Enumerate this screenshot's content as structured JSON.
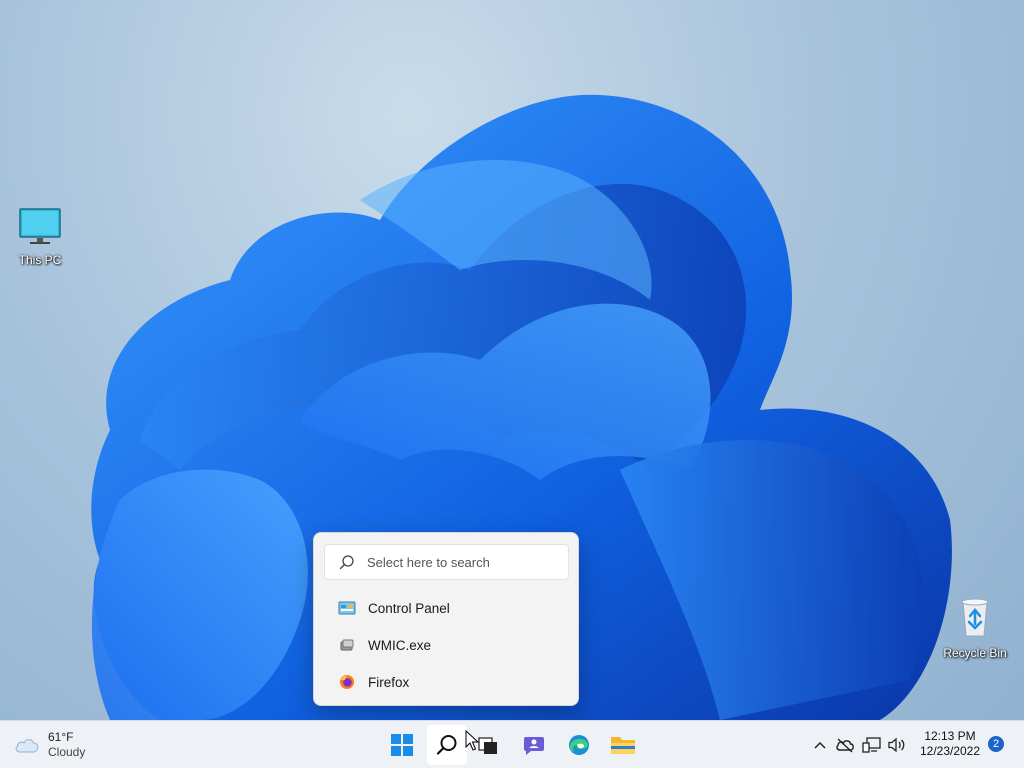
{
  "desktop": {
    "icons": [
      {
        "label": "This PC"
      },
      {
        "label": "Recycle Bin"
      }
    ]
  },
  "search_flyout": {
    "placeholder": "Select here to search",
    "results": [
      {
        "label": "Control Panel",
        "icon": "control-panel-icon"
      },
      {
        "label": "WMIC.exe",
        "icon": "wmic-icon"
      },
      {
        "label": "Firefox",
        "icon": "firefox-icon"
      }
    ]
  },
  "taskbar": {
    "weather": {
      "temp": "61°F",
      "condition": "Cloudy"
    },
    "pinned": [
      "start-icon",
      "search-icon",
      "task-view-icon",
      "chat-icon",
      "edge-icon",
      "file-explorer-icon"
    ],
    "tray_icons": [
      "chevron-up-icon",
      "onedrive-offline-icon",
      "network-icon",
      "volume-icon"
    ],
    "clock": {
      "time": "12:13 PM",
      "date": "12/23/2022"
    },
    "notification_count": "2"
  },
  "colors": {
    "accent": "#1a64c8",
    "bloom_dark": "#0a3fb8",
    "bloom_light": "#2f8cf0"
  }
}
